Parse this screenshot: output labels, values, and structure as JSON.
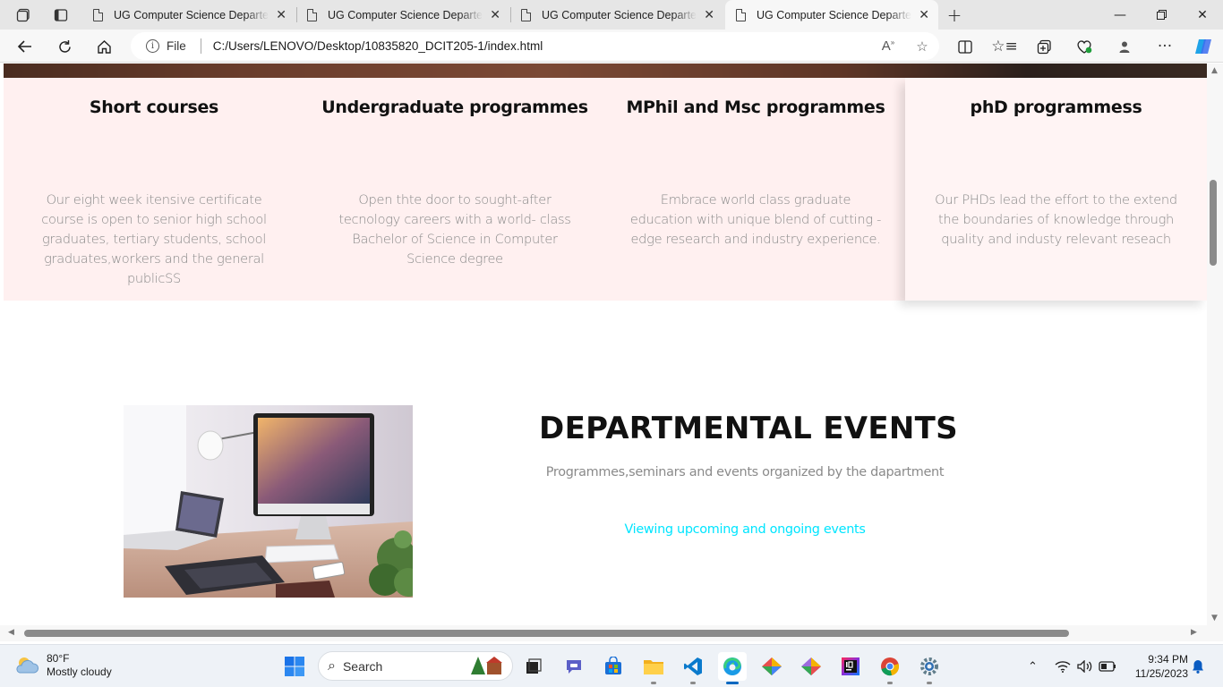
{
  "browser": {
    "tabs": [
      {
        "title": "UG Computer Science Departement",
        "active": false
      },
      {
        "title": "UG Computer Science Departement",
        "active": false
      },
      {
        "title": "UG Computer Science Departement",
        "active": false
      },
      {
        "title": "UG Computer Science Departement",
        "active": true
      }
    ],
    "address": {
      "scheme_label": "File",
      "url": "C:/Users/LENOVO/Desktop/10835820_DCIT205-1/index.html"
    }
  },
  "page": {
    "programmes": [
      {
        "title": "Short courses",
        "description": "Our eight week itensive certificate course is open to senior high school graduates, tertiary students, school graduates,workers and the general publicSS"
      },
      {
        "title": "Undergraduate programmes",
        "description": "Open thte door to sought-after tecnology careers with a world- class Bachelor of Science in Computer Science degree"
      },
      {
        "title": "MPhil and Msc programmes",
        "description": "Embrace world class graduate education with unique blend of cutting -edge research and industry experience."
      },
      {
        "title": "phD programmess",
        "description": "Our PHDs lead the effort to the extend the boundaries of knowledge through quality and industy relevant reseach"
      }
    ],
    "events": {
      "title": "DEPARTMENTAL EVENTS",
      "subtitle": "Programmes,seminars and events organized by the dapartment",
      "link": "Viewing upcoming and ongoing events",
      "link_color": "#00e5ff"
    }
  },
  "taskbar": {
    "weather": {
      "temp": "80°F",
      "condition": "Mostly cloudy"
    },
    "search_label": "Search",
    "time": "9:34 PM",
    "date": "11/25/2023",
    "apps": [
      "file-explorer-icon",
      "vscode-icon",
      "edge-icon",
      "chrome-icon",
      "settings-icon"
    ]
  },
  "colors": {
    "programmes_bg": "#fff0f0",
    "accent_link": "#00e5ff",
    "edge_blue": "#0067c0"
  }
}
